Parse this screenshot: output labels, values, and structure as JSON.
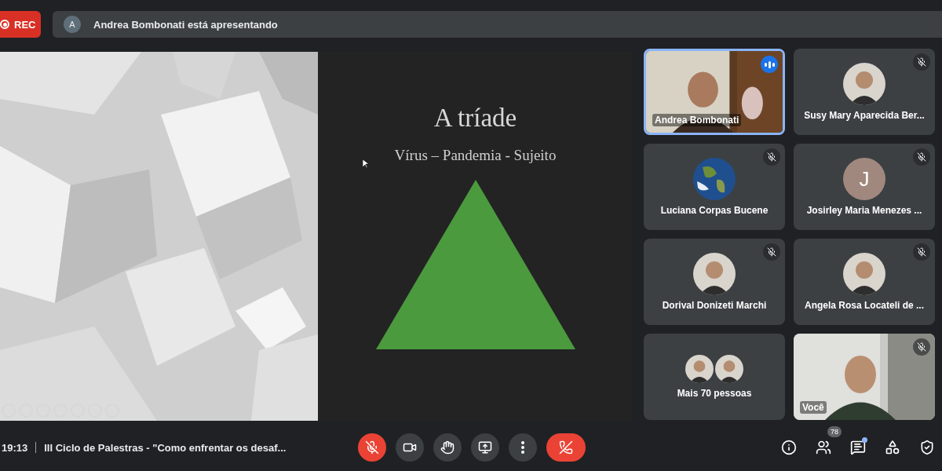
{
  "recording": {
    "label": "REC"
  },
  "presenter": {
    "initial": "A",
    "text": "Andrea Bombonati está apresentando"
  },
  "slide": {
    "title": "A tríade",
    "subtitle": "Vírus – Pandemia - Sujeito"
  },
  "participants": [
    {
      "kind": "video",
      "name": "Andrea Bombonati",
      "speaking": true,
      "muted": false
    },
    {
      "name": "Susy Mary Aparecida Ber...",
      "speaking": false,
      "muted": true
    },
    {
      "name": "Luciana Corpas Bucene",
      "speaking": false,
      "muted": true
    },
    {
      "kind": "letter",
      "name": "Josirley Maria Menezes ...",
      "initial": "J",
      "color": "#a1887f",
      "speaking": false,
      "muted": true
    },
    {
      "name": "Dorival Donizeti Marchi",
      "speaking": false,
      "muted": true
    },
    {
      "name": "Angela Rosa Locateli de ...",
      "speaking": false,
      "muted": true
    },
    {
      "kind": "more",
      "name": "Mais 70 pessoas",
      "speaking": false,
      "muted": false
    },
    {
      "kind": "video",
      "name": "Você",
      "speaking": false,
      "muted": true
    }
  ],
  "footer": {
    "time": "19:13",
    "meeting": "III Ciclo de Palestras - \"Como enfrentar os desaf..."
  },
  "controls": [
    {
      "kind": "mic",
      "muted": true
    },
    {
      "kind": "camera"
    },
    {
      "kind": "hand"
    },
    {
      "kind": "present"
    },
    {
      "kind": "more"
    },
    {
      "kind": "hangup"
    }
  ],
  "side_controls": [
    {
      "kind": "info"
    },
    {
      "kind": "people",
      "badge": "78"
    },
    {
      "kind": "chat",
      "unread": true
    },
    {
      "kind": "activities"
    },
    {
      "kind": "lock"
    }
  ]
}
